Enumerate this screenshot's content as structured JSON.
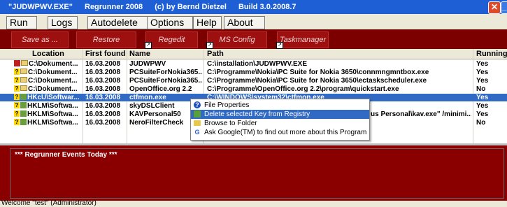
{
  "window": {
    "title_parts": [
      "\"JUDWPWV.EXE\"",
      "Regrunner 2008",
      "(c) by Bernd Dietzel",
      "Build 3.0.2008.7"
    ],
    "close_glyph": "✕",
    "min_glyph": "_"
  },
  "menu": [
    "Run",
    "Logs",
    "Autodelete",
    "Options",
    "Help",
    "About"
  ],
  "toolbar": [
    {
      "label": "Save as ...",
      "icon": "none"
    },
    {
      "label": "Restore",
      "icon": "none"
    },
    {
      "label": "Regedit",
      "icon": "shortcut-arrow-icon"
    },
    {
      "label": "MS Config",
      "icon": "shortcut-arrow-icon"
    },
    {
      "label": "Taskmanager",
      "icon": "shortcut-arrow-icon"
    }
  ],
  "grid": {
    "columns": [
      "Location",
      "First found",
      "Name",
      "Path",
      "Running ?"
    ],
    "rows": [
      {
        "icon": "app-icon",
        "location": "C:\\Dokument...",
        "first_found": "16.03.2008",
        "name": "JUDWPWV",
        "path": "C:\\installation\\JUDWPWV.EXE",
        "running": "Yes"
      },
      {
        "icon": "question-folder-icon",
        "location": "C:\\Dokument...",
        "first_found": "16.03.2008",
        "name": "PCSuiteForNokia365...",
        "path": "C:\\Programme\\Nokia\\PC Suite for Nokia 3650\\connmngmntbox.exe",
        "running": "Yes"
      },
      {
        "icon": "question-folder-icon",
        "location": "C:\\Dokument...",
        "first_found": "16.03.2008",
        "name": "PCSuiteForNokia365...",
        "path": "C:\\Programme\\Nokia\\PC Suite for Nokia 3650\\ectaskscheduler.exe",
        "running": "Yes"
      },
      {
        "icon": "question-folder-icon",
        "location": "C:\\Dokument...",
        "first_found": "16.03.2008",
        "name": "OpenOffice.org 2.2",
        "path": "C:\\Programme\\OpenOffice.org 2.2\\program\\quickstart.exe",
        "running": "No"
      },
      {
        "icon": "question-registry-icon",
        "location": "HKcU\\Softwar...",
        "first_found": "16.03.2008",
        "name": "ctfmon.exe",
        "path": "C:\\WINDOWS\\system32\\ctfmon.exe",
        "running": "Yes"
      },
      {
        "icon": "question-registry-icon",
        "location": "HKLM\\Softwa...",
        "first_found": "16.03.2008",
        "name": "skyDSLClient",
        "path": "",
        "running": "Yes"
      },
      {
        "icon": "question-registry-icon",
        "location": "HKLM\\Softwa...",
        "first_found": "16.03.2008",
        "name": "KAVPersonal50",
        "path": "us Personal\\kav.exe\" /minimi...",
        "running": "Yes"
      },
      {
        "icon": "question-registry-icon",
        "location": "HKLM\\Softwa...",
        "first_found": "16.03.2008",
        "name": "NeroFilterCheck",
        "path": "",
        "running": "No"
      }
    ]
  },
  "context_menu": [
    {
      "label": "File Properties",
      "icon": "help-icon"
    },
    {
      "label": "Delete selected Key from Registry",
      "icon": "registry-delete-icon"
    },
    {
      "label": "Browse to Folder",
      "icon": "folder-icon"
    },
    {
      "label": "Ask Google(TM) to find out more about this Program",
      "icon": "google-icon"
    }
  ],
  "events": {
    "title": "*** Regrunner Events Today ***"
  },
  "status": {
    "text": "Welcome \"test\" (Administrator)"
  },
  "colors": {
    "titlebar": "#1f5fd6",
    "toolbar": "#7c0000",
    "events": "#8a0000",
    "selection": "#316ac5"
  }
}
